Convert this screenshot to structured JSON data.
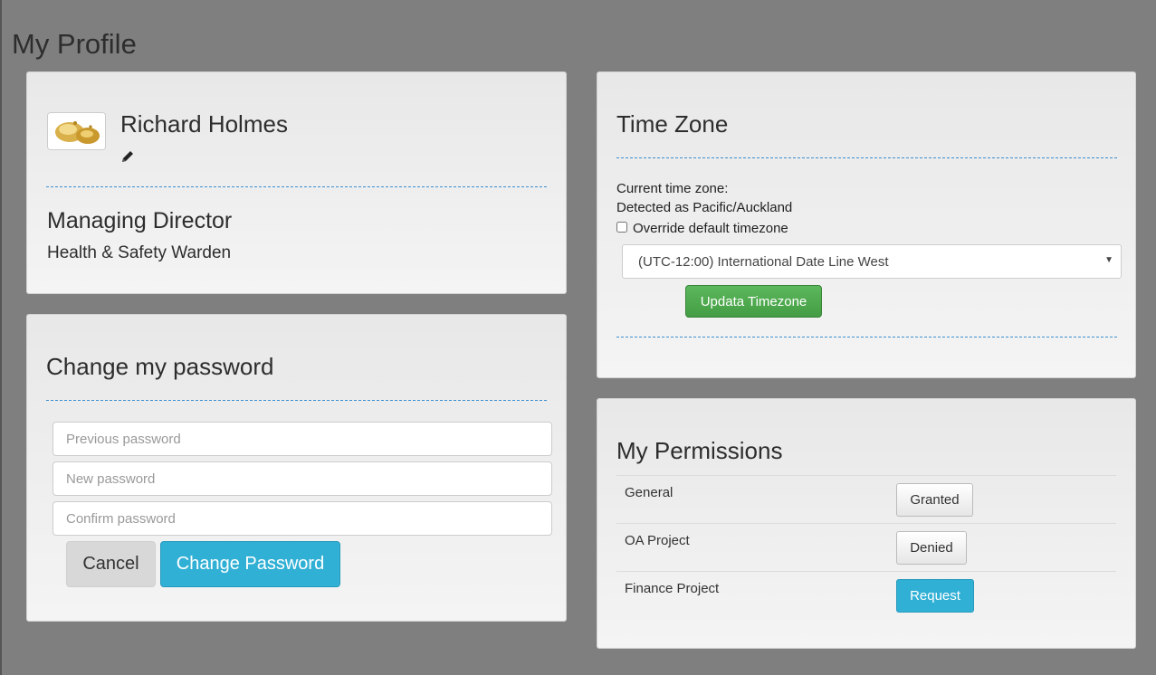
{
  "page": {
    "title": "My Profile"
  },
  "profile": {
    "name": "Richard Holmes",
    "role": "Managing Director",
    "secondary_role": "Health & Safety Warden"
  },
  "password": {
    "title": "Change my password",
    "previous_placeholder": "Previous password",
    "new_placeholder": "New password",
    "confirm_placeholder": "Confirm password",
    "cancel_label": "Cancel",
    "change_label": "Change Password"
  },
  "timezone": {
    "title": "Time Zone",
    "current_label": "Current time zone:",
    "detected": "Detected as Pacific/Auckland",
    "override_label": "Override default timezone",
    "override_checked": false,
    "selected": "(UTC-12:00) International Date Line West",
    "update_label": "Updata Timezone"
  },
  "permissions": {
    "title": "My Permissions",
    "rows": [
      {
        "name": "General",
        "status": "Granted"
      },
      {
        "name": "OA Project",
        "status": "Denied"
      },
      {
        "name": "Finance Project",
        "status": "Request"
      }
    ]
  },
  "colors": {
    "background": "#7f7f7f",
    "primary": "#31b0d5",
    "success": "#5cb85c",
    "divider": "#3a8fd0"
  }
}
